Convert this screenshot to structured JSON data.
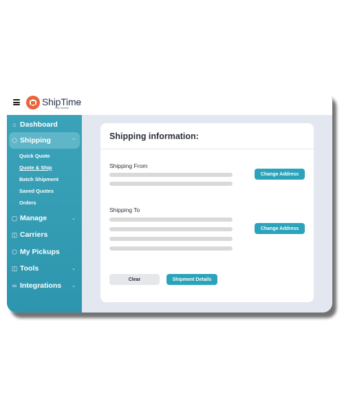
{
  "header": {
    "logo_text": "ShipTime",
    "logo_subtext": "Ship Smarter"
  },
  "sidebar": {
    "items": [
      {
        "label": "Dashboard",
        "icon": "home-icon"
      },
      {
        "label": "Shipping",
        "icon": "box-icon",
        "expanded": true
      },
      {
        "label": "Manage",
        "icon": "monitor-icon"
      },
      {
        "label": "Carriers",
        "icon": "truck-icon"
      },
      {
        "label": "My Pickups",
        "icon": "package-icon"
      },
      {
        "label": "Tools",
        "icon": "toolbox-icon"
      },
      {
        "label": "Integrations",
        "icon": "link-icon"
      }
    ],
    "shipping_sub": [
      {
        "label": "Quick Quote"
      },
      {
        "label": "Quote & Ship",
        "current": true
      },
      {
        "label": "Batch Shipment"
      },
      {
        "label": "Saved Quotes"
      },
      {
        "label": "Orders"
      }
    ]
  },
  "main": {
    "title": "Shipping information:",
    "from_label": "Shipping From",
    "to_label": "Shipping To",
    "change_address_label": "Change Address",
    "clear_label": "Clear",
    "shipment_details_label": "Shipment Details"
  },
  "colors": {
    "sidebar": "#3ba3b9",
    "accent": "#2ba4bb",
    "logo": "#e8643a",
    "content_bg": "#e3e8f0"
  }
}
